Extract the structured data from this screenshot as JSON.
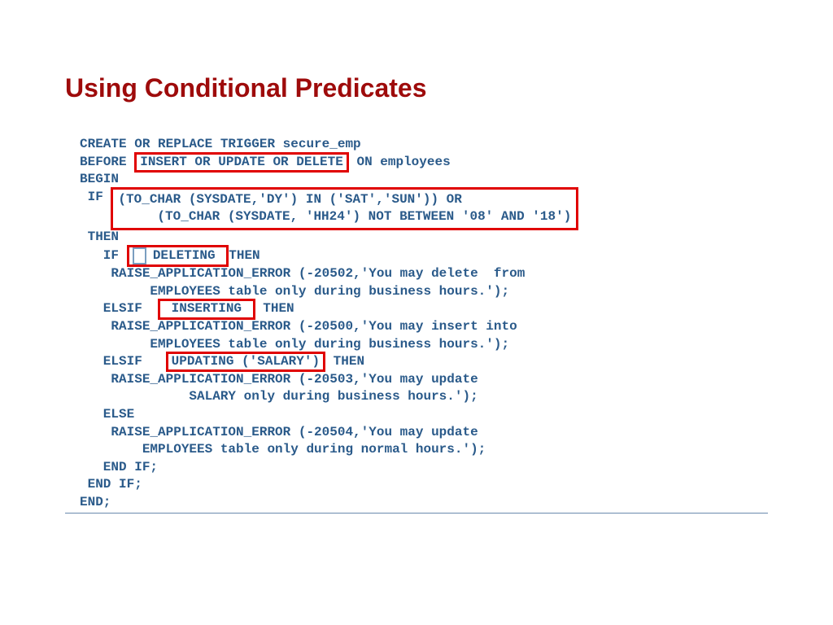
{
  "title": "Using Conditional Predicates",
  "code": {
    "line1": "CREATE OR REPLACE TRIGGER secure_emp",
    "line2a": "BEFORE ",
    "line2b": "INSERT OR UPDATE OR DELETE",
    "line2c": " ON employees",
    "line3": "BEGIN",
    "line4a": " IF ",
    "line4b": "(TO_CHAR (SYSDATE,'DY') IN ('SAT','SUN')) OR\n     (TO_CHAR (SYSDATE, 'HH24') NOT BETWEEN '08' AND '18')",
    "line5": " THEN",
    "line6a": "   IF ",
    "line6blank": " ",
    "line6b": " DELETING ",
    "line6c": "THEN",
    "line7": "    RAISE_APPLICATION_ERROR (-20502,'You may delete  from",
    "line8": "         EMPLOYEES table only during business hours.');",
    "line9a": "   ELSIF  ",
    "line9b": " INSERTING ",
    "line9c": " THEN",
    "line10": "    RAISE_APPLICATION_ERROR (-20500,'You may insert into",
    "line11": "         EMPLOYEES table only during business hours.');",
    "line12a": "   ELSIF   ",
    "line12b": "UPDATING ('SALARY')",
    "line12c": " THEN",
    "line13": "    RAISE_APPLICATION_ERROR (-20503,'You may update",
    "line14": "              SALARY only during business hours.');",
    "line15": "   ELSE",
    "line16": "    RAISE_APPLICATION_ERROR (-20504,'You may update",
    "line17": "        EMPLOYEES table only during normal hours.');",
    "line18": "   END IF;",
    "line19": " END IF;",
    "line20": "END;"
  }
}
